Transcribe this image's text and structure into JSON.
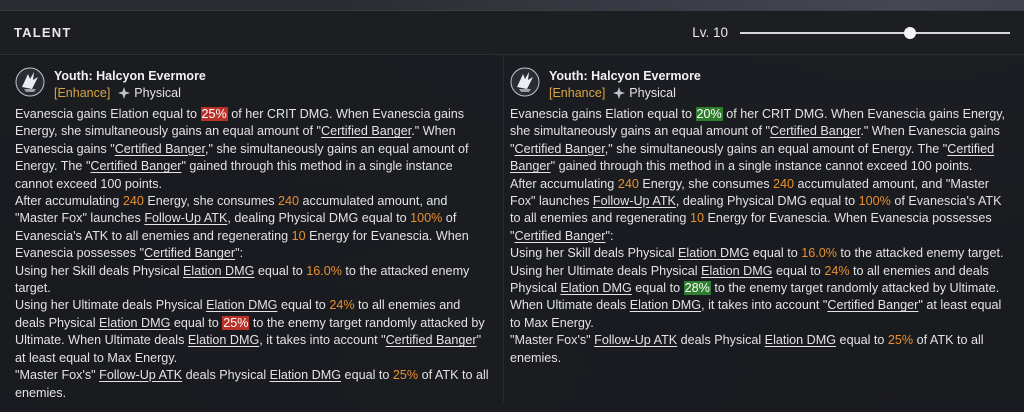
{
  "header": {
    "title": "TALENT",
    "level_label": "Lv. 10",
    "level_fraction": 0.63
  },
  "left": {
    "name": "Youth: Halcyon Evermore",
    "tag": "[Enhance]",
    "type": "Physical",
    "paras": [
      [
        {
          "t": "Evanescia gains Elation equal to "
        },
        {
          "t": "25%",
          "s": "hr"
        },
        {
          "t": " of her CRIT DMG. When Evanescia gains Energy, she simultaneously gains an equal amount of \""
        },
        {
          "t": "Certified Banger",
          "s": "u"
        },
        {
          "t": ".\" When Evanescia gains \""
        },
        {
          "t": "Certified Banger",
          "s": "u"
        },
        {
          "t": ",\" she simultaneously gains an equal amount of Energy. The \""
        },
        {
          "t": "Certified Banger",
          "s": "u"
        },
        {
          "t": "\" gained through this method in a single instance cannot exceed 100 points."
        }
      ],
      [
        {
          "t": "After accumulating "
        },
        {
          "t": "240",
          "s": "o"
        },
        {
          "t": " Energy, she consumes "
        },
        {
          "t": "240",
          "s": "o"
        },
        {
          "t": " accumulated amount, and \"Master Fox\" launches "
        },
        {
          "t": "Follow-Up ATK",
          "s": "u"
        },
        {
          "t": ", dealing Physical DMG equal to "
        },
        {
          "t": "100%",
          "s": "o"
        },
        {
          "t": " of Evanescia's ATK to all enemies and regenerating "
        },
        {
          "t": "10",
          "s": "o"
        },
        {
          "t": " Energy for Evanescia. When Evanescia possesses \""
        },
        {
          "t": "Certified Banger",
          "s": "u"
        },
        {
          "t": "\":"
        }
      ],
      [
        {
          "t": "Using her Skill deals Physical "
        },
        {
          "t": "Elation DMG",
          "s": "u"
        },
        {
          "t": " equal to "
        },
        {
          "t": "16.0%",
          "s": "o"
        },
        {
          "t": " to the attacked enemy target."
        }
      ],
      [
        {
          "t": "Using her Ultimate deals Physical "
        },
        {
          "t": "Elation DMG",
          "s": "u"
        },
        {
          "t": " equal to "
        },
        {
          "t": "24%",
          "s": "o"
        },
        {
          "t": " to all enemies and deals Physical "
        },
        {
          "t": "Elation DMG",
          "s": "u"
        },
        {
          "t": " equal to "
        },
        {
          "t": "25%",
          "s": "hr"
        },
        {
          "t": " to the enemy target randomly attacked by Ultimate. When Ultimate deals "
        },
        {
          "t": "Elation DMG",
          "s": "u"
        },
        {
          "t": ", it takes into account \""
        },
        {
          "t": "Certified Banger",
          "s": "u"
        },
        {
          "t": "\" at least equal to Max Energy."
        }
      ],
      [
        {
          "t": "\"Master Fox's\" "
        },
        {
          "t": "Follow-Up ATK",
          "s": "u"
        },
        {
          "t": " deals Physical "
        },
        {
          "t": "Elation DMG",
          "s": "u"
        },
        {
          "t": " equal to "
        },
        {
          "t": "25%",
          "s": "o"
        },
        {
          "t": " of ATK to all enemies."
        }
      ]
    ]
  },
  "right": {
    "name": "Youth: Halcyon Evermore",
    "tag": "[Enhance]",
    "type": "Physical",
    "paras": [
      [
        {
          "t": "Evanescia gains Elation equal to "
        },
        {
          "t": "20%",
          "s": "hg"
        },
        {
          "t": " of her CRIT DMG. When Evanescia gains Energy, she simultaneously gains an equal amount of \""
        },
        {
          "t": "Certified Banger",
          "s": "u"
        },
        {
          "t": ".\" When Evanescia gains \""
        },
        {
          "t": "Certified Banger",
          "s": "u"
        },
        {
          "t": ",\" she simultaneously gains an equal amount of Energy. The \""
        },
        {
          "t": "Certified Banger",
          "s": "u"
        },
        {
          "t": "\" gained through this method in a single instance cannot exceed 100 points."
        }
      ],
      [
        {
          "t": "After accumulating "
        },
        {
          "t": "240",
          "s": "o"
        },
        {
          "t": " Energy, she consumes "
        },
        {
          "t": "240",
          "s": "o"
        },
        {
          "t": " accumulated amount, and \"Master Fox\" launches "
        },
        {
          "t": "Follow-Up ATK",
          "s": "u"
        },
        {
          "t": ", dealing Physical DMG equal to "
        },
        {
          "t": "100%",
          "s": "o"
        },
        {
          "t": " of Evanescia's ATK to all enemies and regenerating "
        },
        {
          "t": "10",
          "s": "o"
        },
        {
          "t": " Energy for Evanescia. When Evanescia possesses \""
        },
        {
          "t": "Certified Banger",
          "s": "u"
        },
        {
          "t": "\":"
        }
      ],
      [
        {
          "t": "Using her Skill deals Physical "
        },
        {
          "t": "Elation DMG",
          "s": "u"
        },
        {
          "t": " equal to "
        },
        {
          "t": "16.0%",
          "s": "o"
        },
        {
          "t": " to the attacked enemy target."
        }
      ],
      [
        {
          "t": "Using her Ultimate deals Physical "
        },
        {
          "t": "Elation DMG",
          "s": "u"
        },
        {
          "t": " equal to "
        },
        {
          "t": "24%",
          "s": "o"
        },
        {
          "t": " to all enemies and deals Physical "
        },
        {
          "t": "Elation DMG",
          "s": "u"
        },
        {
          "t": " equal to "
        },
        {
          "t": "28%",
          "s": "hg"
        },
        {
          "t": " to the enemy target randomly attacked by Ultimate. When Ultimate deals "
        },
        {
          "t": "Elation DMG",
          "s": "u"
        },
        {
          "t": ", it takes into account \""
        },
        {
          "t": "Certified Banger",
          "s": "u"
        },
        {
          "t": "\" at least equal to Max Energy."
        }
      ],
      [
        {
          "t": "\"Master Fox's\" "
        },
        {
          "t": "Follow-Up ATK",
          "s": "u"
        },
        {
          "t": " deals Physical "
        },
        {
          "t": "Elation DMG",
          "s": "u"
        },
        {
          "t": " equal to "
        },
        {
          "t": "25%",
          "s": "o"
        },
        {
          "t": " of ATK to all enemies."
        }
      ]
    ]
  },
  "icons": {
    "talent": "talent-emblem-icon",
    "type": "physical-type-icon"
  },
  "colors": {
    "highlight_orange": "#e8902f",
    "decrease_red": "#b8322a",
    "increase_green": "#2f7d2f",
    "tag_gold": "#d9a441"
  }
}
